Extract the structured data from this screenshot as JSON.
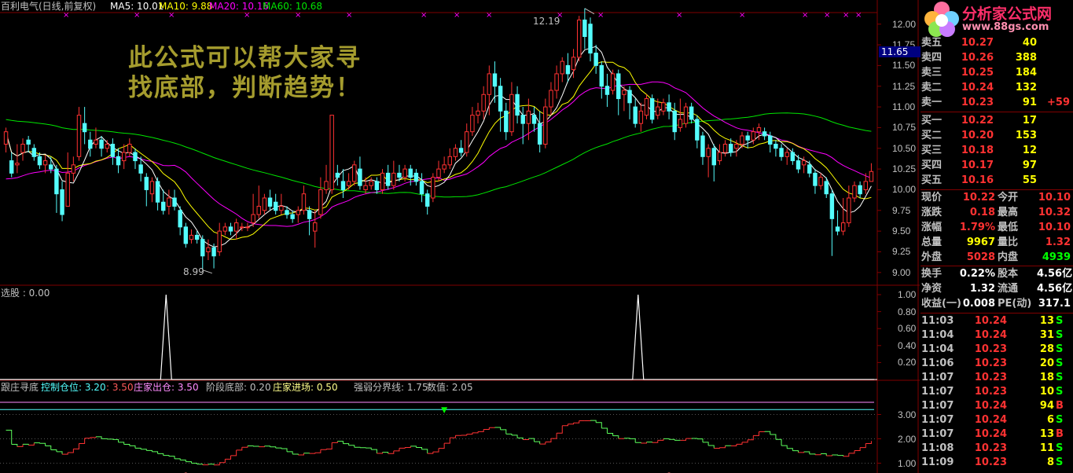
{
  "colors": {
    "up": "#ff3232",
    "down": "#54fcfc",
    "ma5": "#ffffff",
    "ma10": "#ffff00",
    "ma20": "#ff00ff",
    "ma60": "#00e600",
    "grid": "#800000",
    "text": "#c0c0c0",
    "ind_up": "#ff3232",
    "ind_down": "#5cff5c"
  },
  "header": {
    "title": "百利电气(日线,前复权)",
    "ma5": "MA5: 10.01",
    "ma10": "MA10: 9.88",
    "ma20": "MA20: 10.16",
    "ma60": "MA60: 10.68"
  },
  "overlay": {
    "line1": "此公式可以帮大家寻",
    "line2": "找底部，判断趋势！"
  },
  "price_axis": {
    "ticks": [
      "12.00",
      "11.75",
      "11.50",
      "11.25",
      "11.00",
      "10.75",
      "10.50",
      "10.25",
      "10.00",
      "9.75",
      "9.50",
      "9.25",
      "9.00"
    ],
    "current": "11.65",
    "high_label": "12.19",
    "low_label": "8.99"
  },
  "pane2": {
    "label": "选股 : 0.00",
    "ticks": [
      "1.00",
      "0.80",
      "0.60",
      "0.40",
      "0.20"
    ]
  },
  "pane3": {
    "legend": [
      {
        "text": "跟庄寻底",
        "color": "#c0c0c0"
      },
      {
        "text": "控制仓位: 3.20",
        "color": "#54fcfc"
      },
      {
        "text": ": 3.50",
        "color": "#ff5a5a"
      },
      {
        "text": "庄家出仓: 3.50",
        "color": "#ff8cff"
      },
      {
        "text": "阶段底部: 0.20",
        "color": "#c0c0c0"
      },
      {
        "text": "庄家进场: 0.50",
        "color": "#ffff8c"
      },
      {
        "text": "强弱分界线: 1.75",
        "color": "#c0c0c0"
      },
      {
        "text": "数值: 2.05",
        "color": "#c0c0c0"
      }
    ],
    "ticks": [
      "3.00",
      "2.00",
      "1.00"
    ]
  },
  "logo": {
    "title": "分析家公式网",
    "url": "www.88gs.com"
  },
  "quote": {
    "sell": [
      {
        "label": "卖五",
        "price": "10.27",
        "vol": "40"
      },
      {
        "label": "卖四",
        "price": "10.26",
        "vol": "388"
      },
      {
        "label": "卖三",
        "price": "10.25",
        "vol": "184"
      },
      {
        "label": "卖二",
        "price": "10.24",
        "vol": "132"
      },
      {
        "label": "卖一",
        "price": "10.23",
        "vol": "91",
        "extra": "+59"
      }
    ],
    "buy": [
      {
        "label": "买一",
        "price": "10.22",
        "vol": "17"
      },
      {
        "label": "买二",
        "price": "10.20",
        "vol": "153"
      },
      {
        "label": "买三",
        "price": "10.18",
        "vol": "12"
      },
      {
        "label": "买四",
        "price": "10.17",
        "vol": "97"
      },
      {
        "label": "买五",
        "price": "10.16",
        "vol": "55"
      }
    ],
    "stats": [
      {
        "l1": "现价",
        "v1": "10.22",
        "c1": "#ff3232",
        "l2": "今开",
        "v2": "10.10",
        "c2": "#ff3232"
      },
      {
        "l1": "涨跌",
        "v1": "0.18",
        "c1": "#ff3232",
        "l2": "最高",
        "v2": "10.32",
        "c2": "#ff3232"
      },
      {
        "l1": "涨幅",
        "v1": "1.79%",
        "c1": "#ff3232",
        "l2": "最低",
        "v2": "10.10",
        "c2": "#ff3232"
      },
      {
        "l1": "总量",
        "v1": "9967",
        "c1": "#ffff00",
        "l2": "量比",
        "v2": "1.32",
        "c2": "#ff3232"
      },
      {
        "l1": "外盘",
        "v1": "5028",
        "c1": "#ff3232",
        "l2": "内盘",
        "v2": "4939",
        "c2": "#00ff00"
      }
    ],
    "fund": [
      {
        "l1": "换手",
        "v1": "0.22%",
        "l2": "股本",
        "v2": "4.56亿"
      },
      {
        "l1": "净资",
        "v1": "1.32",
        "l2": "流通",
        "v2": "4.56亿"
      },
      {
        "l1": "收益(一)",
        "v1": "0.008",
        "l2": "PE(动)",
        "v2": "317.1"
      }
    ],
    "ticks": [
      {
        "t": "11:03",
        "p": "10.24",
        "v": "13",
        "s": "S"
      },
      {
        "t": "11:04",
        "p": "10.24",
        "v": "31",
        "s": "S"
      },
      {
        "t": "11:04",
        "p": "10.23",
        "v": "28",
        "s": "S"
      },
      {
        "t": "11:06",
        "p": "10.23",
        "v": "20",
        "s": "S"
      },
      {
        "t": "11:07",
        "p": "10.23",
        "v": "18",
        "s": "S"
      },
      {
        "t": "11:07",
        "p": "10.23",
        "v": "10",
        "s": "S"
      },
      {
        "t": "11:07",
        "p": "10.24",
        "v": "94",
        "s": "B"
      },
      {
        "t": "11:07",
        "p": "10.24",
        "v": "6",
        "s": "S"
      },
      {
        "t": "11:07",
        "p": "10.24",
        "v": "13",
        "s": "B"
      },
      {
        "t": "11:08",
        "p": "10.23",
        "v": "11",
        "s": "S"
      },
      {
        "t": "11:09",
        "p": "10.23",
        "v": "8",
        "s": "S"
      }
    ]
  },
  "chart_data": {
    "type": "candlestick",
    "price_range": [
      8.875,
      12.13
    ],
    "candles": [
      [
        10.55,
        10.7,
        10.45,
        10.75
      ],
      [
        10.35,
        10.2,
        10.15,
        10.45
      ],
      [
        10.3,
        10.32,
        10.2,
        10.55
      ],
      [
        10.45,
        10.55,
        10.35,
        10.62
      ],
      [
        10.6,
        10.55,
        10.45,
        10.65
      ],
      [
        10.5,
        10.4,
        10.35,
        10.55
      ],
      [
        10.4,
        10.3,
        10.25,
        10.45
      ],
      [
        10.3,
        10.35,
        10.2,
        10.42
      ],
      [
        10.3,
        10.25,
        10.2,
        10.4
      ],
      [
        10.25,
        9.95,
        9.72,
        10.3
      ],
      [
        10.0,
        9.7,
        9.62,
        10.1
      ],
      [
        9.8,
        10.2,
        9.8,
        10.45
      ],
      [
        10.2,
        10.3,
        10.1,
        10.4
      ],
      [
        10.4,
        10.9,
        10.35,
        11.0
      ],
      [
        10.8,
        10.7,
        10.55,
        11.0
      ],
      [
        10.6,
        10.5,
        10.4,
        10.7
      ],
      [
        10.55,
        10.6,
        10.5,
        10.75
      ],
      [
        10.6,
        10.5,
        10.4,
        10.65
      ],
      [
        10.5,
        10.55,
        10.45,
        10.6
      ],
      [
        10.55,
        10.4,
        10.3,
        10.62
      ],
      [
        10.4,
        10.3,
        10.2,
        10.5
      ],
      [
        10.35,
        10.45,
        10.25,
        10.55
      ],
      [
        10.45,
        10.55,
        10.4,
        10.62
      ],
      [
        10.45,
        10.35,
        10.25,
        10.5
      ],
      [
        10.3,
        10.2,
        10.1,
        10.4
      ],
      [
        10.15,
        10.0,
        9.8,
        10.2
      ],
      [
        9.95,
        10.1,
        9.85,
        10.15
      ],
      [
        10.1,
        9.85,
        9.75,
        10.15
      ],
      [
        9.85,
        9.75,
        9.7,
        10.0
      ],
      [
        9.8,
        9.9,
        9.7,
        10.0
      ],
      [
        9.9,
        9.8,
        9.75,
        10.0
      ],
      [
        9.75,
        9.55,
        9.45,
        9.8
      ],
      [
        9.55,
        9.35,
        9.3,
        9.6
      ],
      [
        9.4,
        9.45,
        9.35,
        9.52
      ],
      [
        9.45,
        9.4,
        9.35,
        9.5
      ],
      [
        9.4,
        9.2,
        9.03,
        9.45
      ],
      [
        9.25,
        9.3,
        9.15,
        9.4
      ],
      [
        9.3,
        9.2,
        9.05,
        9.35
      ],
      [
        9.25,
        9.5,
        9.2,
        9.6
      ],
      [
        9.5,
        9.55,
        9.45,
        9.6
      ],
      [
        9.55,
        9.5,
        9.45,
        9.6
      ],
      [
        9.5,
        9.6,
        9.4,
        9.65
      ],
      [
        9.55,
        9.55,
        9.5,
        9.6
      ],
      [
        9.55,
        9.55,
        9.5,
        9.6
      ],
      [
        9.6,
        9.7,
        9.55,
        9.95
      ],
      [
        9.7,
        9.8,
        9.65,
        10.05
      ],
      [
        9.75,
        9.9,
        9.7,
        9.95
      ],
      [
        9.9,
        9.8,
        9.75,
        10.0
      ],
      [
        9.85,
        9.75,
        9.7,
        9.95
      ],
      [
        9.75,
        9.8,
        9.7,
        9.95
      ],
      [
        9.75,
        9.7,
        9.65,
        9.8
      ],
      [
        9.7,
        9.65,
        9.6,
        9.75
      ],
      [
        9.7,
        9.75,
        9.6,
        9.8
      ],
      [
        9.75,
        9.95,
        9.7,
        10.05
      ],
      [
        9.75,
        9.65,
        9.45,
        9.8
      ],
      [
        9.5,
        9.6,
        9.3,
        9.75
      ],
      [
        9.7,
        10.0,
        9.65,
        10.15
      ],
      [
        10.0,
        10.1,
        9.95,
        10.3
      ],
      [
        10.0,
        10.9,
        9.95,
        10.9
      ],
      [
        10.2,
        10.15,
        10.05,
        10.3
      ],
      [
        10.1,
        10.0,
        9.9,
        10.25
      ],
      [
        10.05,
        10.1,
        10.0,
        10.2
      ],
      [
        10.1,
        10.3,
        10.05,
        10.35
      ],
      [
        10.25,
        10.05,
        10.0,
        10.4
      ],
      [
        10.0,
        10.05,
        9.95,
        10.15
      ],
      [
        10.05,
        10.1,
        10.0,
        10.15
      ],
      [
        10.1,
        10.0,
        9.95,
        10.15
      ],
      [
        10.0,
        10.2,
        9.95,
        10.25
      ],
      [
        10.2,
        10.05,
        10.0,
        10.3
      ],
      [
        10.05,
        10.2,
        10.0,
        10.35
      ],
      [
        10.2,
        10.15,
        10.1,
        10.3
      ],
      [
        10.15,
        10.25,
        10.1,
        10.3
      ],
      [
        10.25,
        10.15,
        10.05,
        10.3
      ],
      [
        10.2,
        10.1,
        10.05,
        10.25
      ],
      [
        10.1,
        9.95,
        9.85,
        10.2
      ],
      [
        9.95,
        9.8,
        9.7,
        10.0
      ],
      [
        9.9,
        10.15,
        9.85,
        10.2
      ],
      [
        10.15,
        10.25,
        10.1,
        10.35
      ],
      [
        10.25,
        10.3,
        10.2,
        10.4
      ],
      [
        10.3,
        10.4,
        10.25,
        10.5
      ],
      [
        10.4,
        10.5,
        10.35,
        10.55
      ],
      [
        10.5,
        10.45,
        10.4,
        10.6
      ],
      [
        10.45,
        10.7,
        10.4,
        10.8
      ],
      [
        10.7,
        10.9,
        10.65,
        11.0
      ],
      [
        10.9,
        10.95,
        10.8,
        11.05
      ],
      [
        10.95,
        11.15,
        10.85,
        11.25
      ],
      [
        11.15,
        11.4,
        10.9,
        11.5
      ],
      [
        11.4,
        11.25,
        11.05,
        11.55
      ],
      [
        11.25,
        10.95,
        10.7,
        11.35
      ],
      [
        10.95,
        10.7,
        10.6,
        11.05
      ],
      [
        10.7,
        11.15,
        10.65,
        11.3
      ],
      [
        11.15,
        10.9,
        10.8,
        11.25
      ],
      [
        10.9,
        10.8,
        10.55,
        11.0
      ],
      [
        10.8,
        10.95,
        10.6,
        11.1
      ],
      [
        10.9,
        10.8,
        10.7,
        11.0
      ],
      [
        10.8,
        10.55,
        10.45,
        10.95
      ],
      [
        10.55,
        11.0,
        10.5,
        11.1
      ],
      [
        11.0,
        11.2,
        10.9,
        11.3
      ],
      [
        11.2,
        11.4,
        11.1,
        11.5
      ],
      [
        11.4,
        11.55,
        11.3,
        11.6
      ],
      [
        11.5,
        11.4,
        11.3,
        11.65
      ],
      [
        11.45,
        11.6,
        11.35,
        11.7
      ],
      [
        11.6,
        12.05,
        11.55,
        12.1
      ],
      [
        12.05,
        11.85,
        11.7,
        12.19
      ],
      [
        12.0,
        11.65,
        11.55,
        12.08
      ],
      [
        11.65,
        11.5,
        11.4,
        11.75
      ],
      [
        11.5,
        11.25,
        11.1,
        11.55
      ],
      [
        11.25,
        11.15,
        11.0,
        11.4
      ],
      [
        11.2,
        11.4,
        11.15,
        11.45
      ],
      [
        11.4,
        11.1,
        10.9,
        11.45
      ],
      [
        11.15,
        11.2,
        10.95,
        11.25
      ],
      [
        11.2,
        11.05,
        10.85,
        11.25
      ],
      [
        11.0,
        10.8,
        10.75,
        11.1
      ],
      [
        10.8,
        10.95,
        10.7,
        11.05
      ],
      [
        10.9,
        11.1,
        10.85,
        11.15
      ],
      [
        11.1,
        10.85,
        10.8,
        11.15
      ],
      [
        10.9,
        11.0,
        10.85,
        11.1
      ],
      [
        10.95,
        11.05,
        10.9,
        11.1
      ],
      [
        11.05,
        10.95,
        10.85,
        11.15
      ],
      [
        10.95,
        10.7,
        10.6,
        11.05
      ],
      [
        10.75,
        10.85,
        10.7,
        11.1
      ],
      [
        10.8,
        11.0,
        10.75,
        11.05
      ],
      [
        11.0,
        10.85,
        10.8,
        11.05
      ],
      [
        10.85,
        10.6,
        10.5,
        10.9
      ],
      [
        10.65,
        10.4,
        10.3,
        10.7
      ],
      [
        10.4,
        10.5,
        10.15,
        10.55
      ],
      [
        10.5,
        10.3,
        10.1,
        10.55
      ],
      [
        10.35,
        10.45,
        10.3,
        10.55
      ],
      [
        10.45,
        10.55,
        10.4,
        10.6
      ],
      [
        10.55,
        10.45,
        10.4,
        10.62
      ],
      [
        10.5,
        10.55,
        10.4,
        10.6
      ],
      [
        10.55,
        10.65,
        10.5,
        10.7
      ],
      [
        10.65,
        10.6,
        10.5,
        10.7
      ],
      [
        10.6,
        10.7,
        10.55,
        10.75
      ],
      [
        10.7,
        10.75,
        10.6,
        10.8
      ],
      [
        10.7,
        10.65,
        10.6,
        10.75
      ],
      [
        10.65,
        10.55,
        10.45,
        10.7
      ],
      [
        10.55,
        10.5,
        10.4,
        10.6
      ],
      [
        10.5,
        10.4,
        10.35,
        10.55
      ],
      [
        10.4,
        10.45,
        10.3,
        10.5
      ],
      [
        10.45,
        10.35,
        10.3,
        10.5
      ],
      [
        10.35,
        10.25,
        10.2,
        10.42
      ],
      [
        10.3,
        10.35,
        10.2,
        10.4
      ],
      [
        10.3,
        10.2,
        10.15,
        10.35
      ],
      [
        10.2,
        10.05,
        9.95,
        10.25
      ],
      [
        10.05,
        10.15,
        10.0,
        10.2
      ],
      [
        10.1,
        9.95,
        9.9,
        10.15
      ],
      [
        9.95,
        9.65,
        9.2,
        10.0
      ],
      [
        9.55,
        9.5,
        9.45,
        9.75
      ],
      [
        9.5,
        9.6,
        9.45,
        9.9
      ],
      [
        9.6,
        9.9,
        9.55,
        10.05
      ],
      [
        9.9,
        10.05,
        9.85,
        10.1
      ],
      [
        10.05,
        9.95,
        9.9,
        10.1
      ],
      [
        10.0,
        10.1,
        9.95,
        10.2
      ],
      [
        10.1,
        10.22,
        10.1,
        10.32
      ]
    ],
    "signal_peaks": [
      0.19,
      0.73
    ],
    "indicator_levels": {
      "control": 3.2,
      "exit": 3.5,
      "bottom": 0.2,
      "entry": 0.5,
      "divide": 1.75,
      "value": 2.05
    }
  }
}
